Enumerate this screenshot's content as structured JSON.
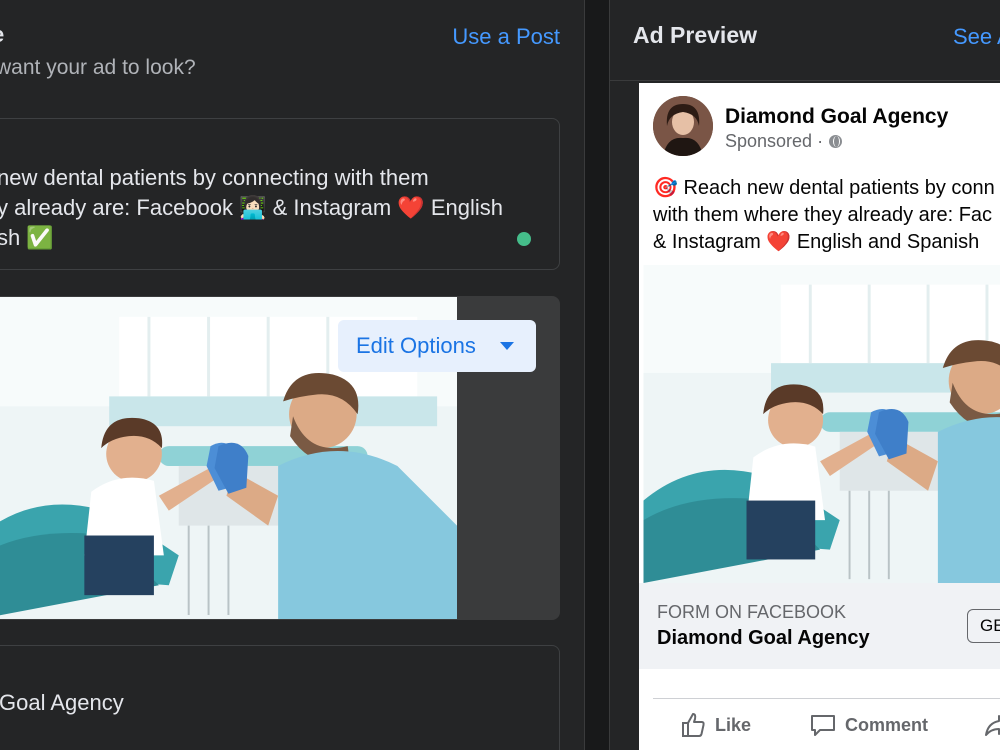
{
  "left_panel": {
    "title_fragment": "e",
    "use_post_link": "Use a Post",
    "subtitle_fragment": "want your ad to look?",
    "primary_text_lines": [
      "new dental patients by connecting with them",
      "y already are: Facebook 👩🏻‍💻 & Instagram ❤️ English",
      "sh ✅"
    ],
    "edit_options_label": "Edit Options",
    "headline_value_fragment": "Goal Agency"
  },
  "right_panel": {
    "title": "Ad Preview",
    "see_link_fragment": "See A",
    "post": {
      "page_name": "Diamond Goal Agency",
      "sponsored_label": "Sponsored ·",
      "ad_text_lines": [
        "🎯 Reach new dental patients by conn",
        "with them where they already are: Fac",
        "& Instagram ❤️ English and Spanish"
      ],
      "cta_type": "FORM ON FACEBOOK",
      "cta_name": "Diamond Goal Agency",
      "cta_button_fragment": "GE",
      "actions": {
        "like": "Like",
        "comment": "Comment"
      }
    }
  },
  "colors": {
    "panel_bg": "#242526",
    "link_blue": "#4599ff",
    "edit_button_bg": "#e7f0fd",
    "status_green": "#45bd8a"
  }
}
